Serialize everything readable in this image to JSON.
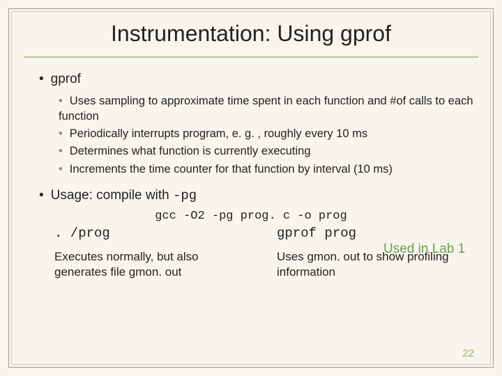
{
  "title": "Instrumentation: Using gprof",
  "bullets": {
    "gprof": "gprof",
    "sub": [
      "Uses sampling to approximate time spent in each function and #of calls to each function",
      "Periodically interrupts program, e. g. , roughly every 10 ms",
      "Determines what function is currently executing",
      "Increments the time counter for that function by interval (10 ms)"
    ],
    "usage_prefix": "Usage: compile with ",
    "usage_flag": "-pg"
  },
  "code_line": "gcc -O2 -pg prog. c -o prog",
  "callout": "Used in Lab 1",
  "cols": {
    "left": {
      "head": ". /prog",
      "body": "Executes normally, but also generates file gmon. out"
    },
    "right": {
      "head": "gprof prog",
      "body": "Uses gmon. out to show profiling information"
    }
  },
  "page_number": "22"
}
